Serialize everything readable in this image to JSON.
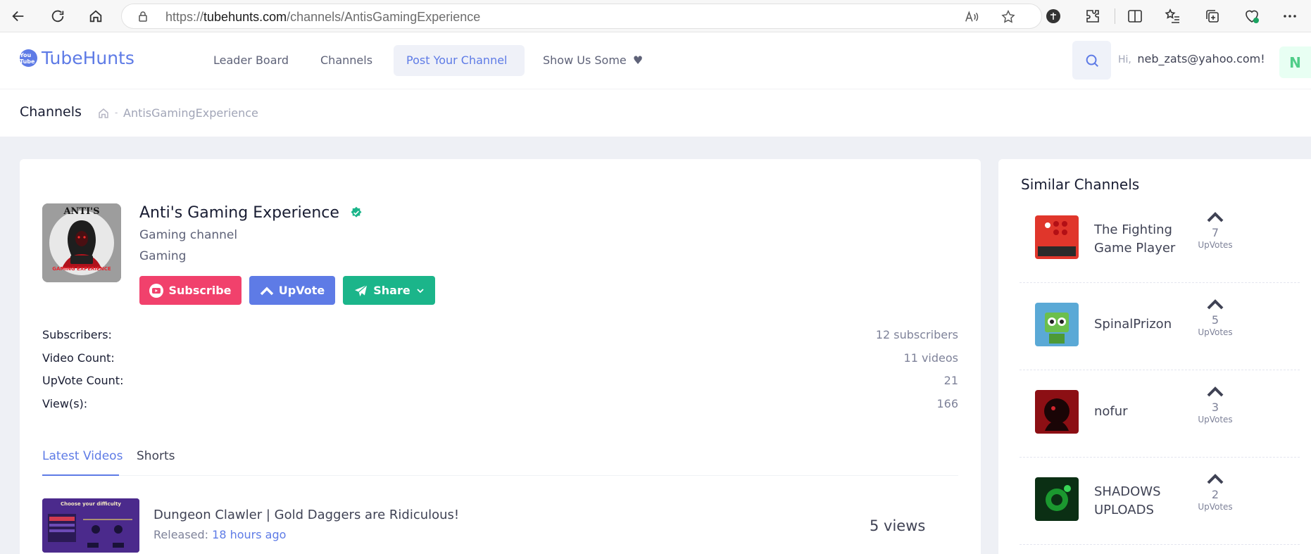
{
  "browser": {
    "url_prefix": "https://",
    "url_host": "tubehunts.com",
    "url_path": "/channels/AntisGamingExperience"
  },
  "site": {
    "logo_badge": "You Tube",
    "logo_text": "TubeHunts",
    "nav": [
      {
        "label": "Leader Board"
      },
      {
        "label": "Channels"
      },
      {
        "label": "Post Your Channel"
      },
      {
        "label": "Show Us Some"
      }
    ],
    "greeting": "Hi,",
    "user_email": "neb_zats@yahoo.com!",
    "avatar_letter": "N"
  },
  "breadcrumb": {
    "title": "Channels",
    "separator": "-",
    "current": "AntisGamingExperience"
  },
  "channel": {
    "name": "Anti's Gaming Experience",
    "description": "Gaming channel",
    "category": "Gaming",
    "image_text_top": "ANTI'S",
    "image_text_bottom": "GAMING EXPERIENCE",
    "buttons": {
      "subscribe": "Subscribe",
      "upvote": "UpVote",
      "share": "Share"
    },
    "stats": [
      {
        "label": "Subscribers:",
        "value": "12 subscribers"
      },
      {
        "label": "Video Count:",
        "value": "11 videos"
      },
      {
        "label": "UpVote Count:",
        "value": "21"
      },
      {
        "label": "View(s):",
        "value": "166"
      }
    ],
    "tabs": [
      {
        "label": "Latest Videos"
      },
      {
        "label": "Shorts"
      }
    ],
    "videos": [
      {
        "title": "Dungeon Clawler | Gold Daggers are Ridiculous!",
        "released_label": "Released:",
        "released_ago": "18 hours ago",
        "views": "5 views",
        "thumb_heading": "Choose your difficulty"
      }
    ]
  },
  "similar": {
    "title": "Similar Channels",
    "vote_label": "UpVotes",
    "items": [
      {
        "name": "The Fighting Game Player",
        "votes": "7",
        "thumb_color": "#e0362b"
      },
      {
        "name": "SpinalPrizon",
        "votes": "5",
        "thumb_color": "#5aa9d6"
      },
      {
        "name": "nofur",
        "votes": "3",
        "thumb_color": "#8c0f14"
      },
      {
        "name": "SHADOWS UPLOADS",
        "votes": "2",
        "thumb_color": "#0b2f14"
      }
    ]
  },
  "colors": {
    "primary": "#5e7be6",
    "danger": "#f1416c",
    "success": "#1bb58a"
  }
}
